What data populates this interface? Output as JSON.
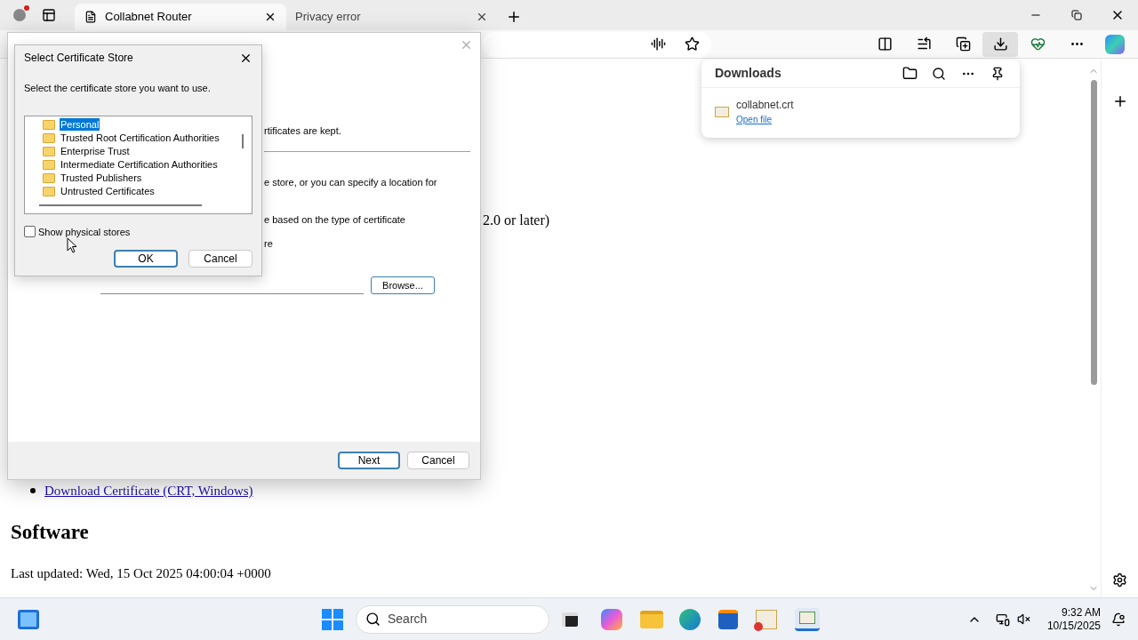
{
  "browser": {
    "tabs": [
      {
        "title": "Collabnet Router",
        "selected": true
      },
      {
        "title": "Privacy error",
        "selected": false
      }
    ],
    "downloads_button": {
      "active": true
    }
  },
  "page": {
    "partial_line": "2.0 or later)",
    "links": [
      "Download Certificate (CRT, Windows)"
    ],
    "heading": "Software",
    "updated": "Last updated: Wed, 15 Oct 2025 04:00:04 +0000"
  },
  "downloads_panel": {
    "title": "Downloads",
    "items": [
      {
        "file": "collabnet.crt",
        "action": "Open file"
      }
    ]
  },
  "import_wizard": {
    "lines": [
      "rtificates are kept.",
      "e store, or you can specify a location for",
      "e based on the type of certificate",
      "re"
    ],
    "browse_button": "Browse...",
    "buttons": [
      {
        "label": "Next",
        "default": true
      },
      {
        "label": "Cancel",
        "default": false
      }
    ]
  },
  "dialog": {
    "title": "Select Certificate Store",
    "prompt": "Select the certificate store you want to use.",
    "stores": [
      {
        "name": "Personal",
        "selected": true
      },
      {
        "name": "Trusted Root Certification Authorities",
        "selected": false
      },
      {
        "name": "Enterprise Trust",
        "selected": false
      },
      {
        "name": "Intermediate Certification Authorities",
        "selected": false
      },
      {
        "name": "Trusted Publishers",
        "selected": false
      },
      {
        "name": "Untrusted Certificates",
        "selected": false
      }
    ],
    "show_physical_stores": {
      "label": "Show physical stores",
      "checked": false
    },
    "buttons": [
      {
        "label": "OK",
        "default": true
      },
      {
        "label": "Cancel",
        "default": false
      }
    ]
  },
  "taskbar": {
    "search_placeholder": "Search",
    "time": "9:32 AM",
    "date": "10/15/2025"
  }
}
